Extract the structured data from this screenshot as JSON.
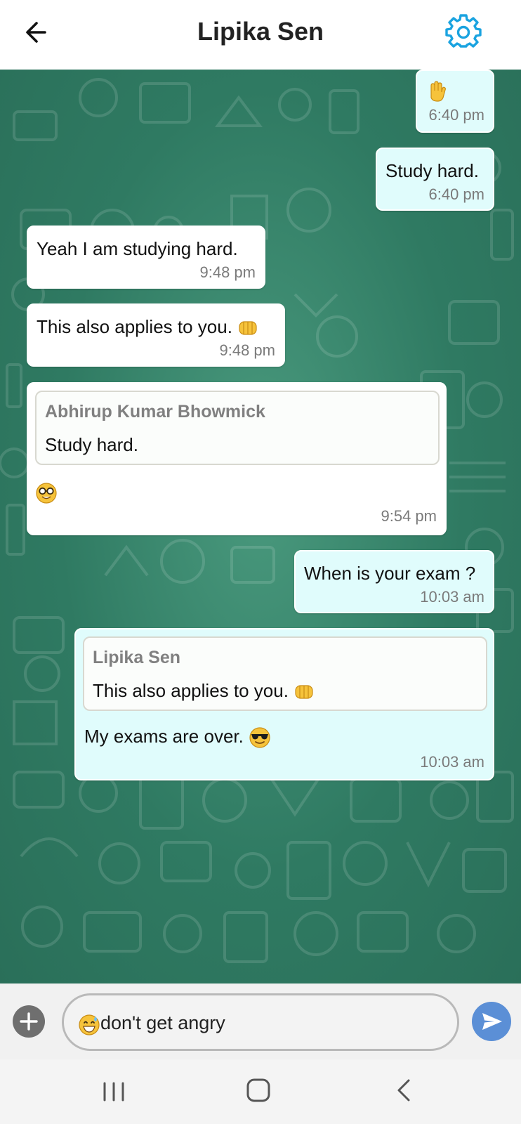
{
  "header": {
    "title": "Lipika Sen",
    "back_icon": "arrow-left-icon",
    "settings_icon": "gear-icon",
    "accent_color": "#1aa3e0"
  },
  "messages": [
    {
      "direction": "out",
      "emoji": "waving-hand",
      "text": "",
      "time": "6:40 pm"
    },
    {
      "direction": "out",
      "text": "Study hard.",
      "time": "6:40 pm"
    },
    {
      "direction": "in",
      "text": "Yeah I am studying hard.",
      "time": "9:48 pm"
    },
    {
      "direction": "in",
      "text": "This also applies to you.",
      "emoji": "oncoming-fist",
      "time": "9:48 pm"
    },
    {
      "direction": "in",
      "quote": {
        "author": "Abhirup Kumar Bhowmick",
        "text": "Study hard."
      },
      "emoji": "nerd-face",
      "text": "",
      "time": "9:54 pm"
    },
    {
      "direction": "out",
      "text": "When is your exam ?",
      "time": "10:03 am"
    },
    {
      "direction": "out",
      "quote": {
        "author": "Lipika Sen",
        "text": "This also applies to you."
      },
      "quote_emoji": "oncoming-fist",
      "text": "My exams are over. ",
      "emoji": "smiling-face-with-sunglasses",
      "time": "10:03 am"
    }
  ],
  "composer": {
    "emoji": "grinning-face-with-sweat",
    "input_value": "don't get angry",
    "add_icon": "plus-icon",
    "send_icon": "send-icon"
  },
  "navbar": {
    "recents_icon": "recents-icon",
    "home_icon": "home-icon",
    "back_icon": "nav-back-icon"
  },
  "colors": {
    "chat_bg": "#3a8a6e",
    "outgoing_bubble": "#e0fcfc",
    "incoming_bubble": "#ffffff",
    "send_button": "#5b8fd6"
  }
}
